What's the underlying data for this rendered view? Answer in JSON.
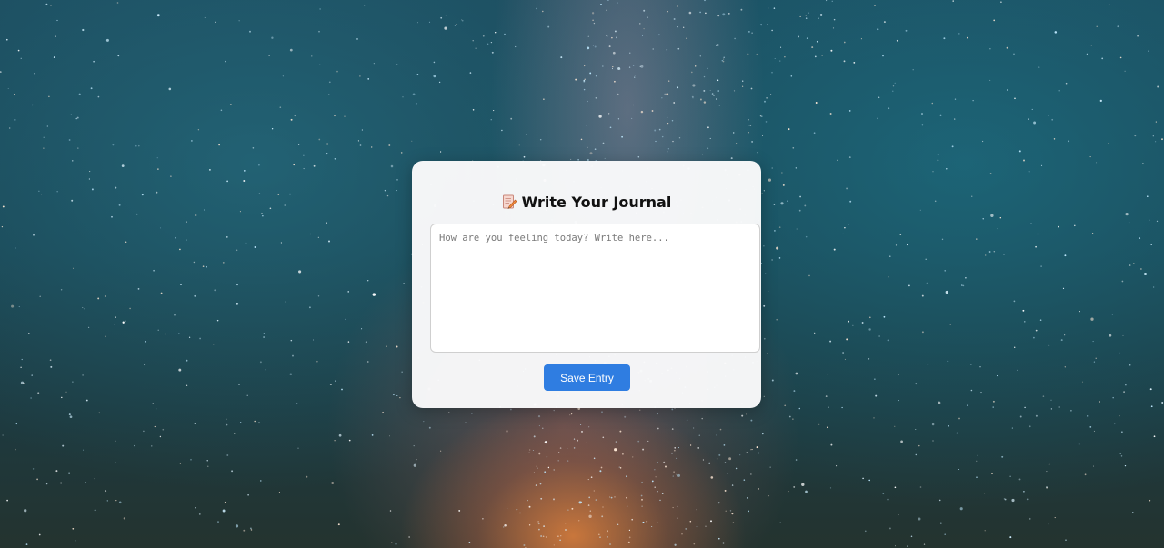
{
  "journal": {
    "title": "Write Your Journal",
    "title_icon": "memo-icon",
    "entry_placeholder": "How are you feeling today? Write here...",
    "entry_value": "",
    "save_label": "Save Entry"
  },
  "colors": {
    "accent": "#2f7de1",
    "card_background": "#fafafb",
    "sky_top": "#1c4a5c",
    "horizon_glow": "#e0803c"
  }
}
